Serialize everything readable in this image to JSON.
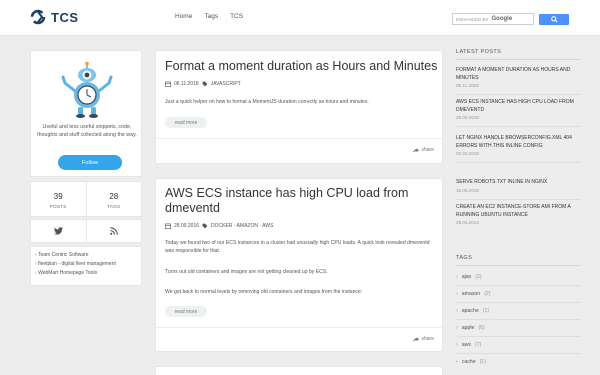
{
  "header": {
    "logo_text": "TCS",
    "nav": [
      "Home",
      "Tags",
      "TCS"
    ],
    "search_label": "ENHANCED BY",
    "search_brand": "Google"
  },
  "profile": {
    "bio": "Useful and less useful snippets, code, thoughts and stuff collected along the way.",
    "follow_label": "Follow",
    "posts_count": "39",
    "posts_label": "POSTS",
    "tags_count": "28",
    "tags_label": "TAGS"
  },
  "links": [
    "Team Centric Software",
    "fleetplan - digital fleet management",
    "WebMart Homepage Tools"
  ],
  "posts": [
    {
      "title": "Format a moment duration as Hours and Minutes",
      "date": "06.11.2018",
      "tags": "JAVASCRIPT",
      "paragraphs": [
        "Just a quick helper on how to format a MomentJS duration correctly as hours and minutes."
      ],
      "more_label": "read more",
      "share_label": "share"
    },
    {
      "title": "AWS ECS instance has high CPU load from dmeventd",
      "date": "28.09.2016",
      "tags": "DOCKER · AMAZON · AWS",
      "paragraphs": [
        "Today we found two of our ECS instances in a cluster had unusually high CPU loads. A quick look revealed dmeventd was responsible for that.",
        "Turns out old containers and images are not getting cleaned up by ECS.",
        "We got back to normal levels by removing old containers and images from the instance:"
      ],
      "more_label": "read more",
      "share_label": "share"
    }
  ],
  "latest": {
    "title": "LATEST POSTS",
    "items": [
      {
        "title": "FORMAT A MOMENT DURATION AS HOURS AND MINUTES",
        "date": "06.11.2018"
      },
      {
        "title": "AWS ECS INSTANCE HAS HIGH CPU LOAD FROM DMEVENTD",
        "date": "28.09.2016"
      },
      {
        "title": "LET NGINX HANDLE BROWSERCONFIG.XML 404 ERRORS WITH THIS INLINE CONFIG",
        "date": "02.02.2016"
      },
      {
        "title": "SERVE ROBOTS.TXT INLINE IN NGINX",
        "date": "16.06.2015"
      },
      {
        "title": "CREATE AN EC2 INSTANCE-STORE AMI FROM A RUNNING UBUNTU INSTANCE",
        "date": "29.04.2014"
      }
    ]
  },
  "tags": {
    "title": "TAGS",
    "items": [
      {
        "name": "ajax",
        "count": "(2)"
      },
      {
        "name": "amazon",
        "count": "(2)"
      },
      {
        "name": "apache",
        "count": "(1)"
      },
      {
        "name": "apple",
        "count": "(6)"
      },
      {
        "name": "aws",
        "count": "(7)"
      },
      {
        "name": "cache",
        "count": "(1)"
      }
    ]
  },
  "colors": {
    "accent": "#35a4e8",
    "brand": "#1b3f66",
    "google_button": "#4d90fe"
  }
}
